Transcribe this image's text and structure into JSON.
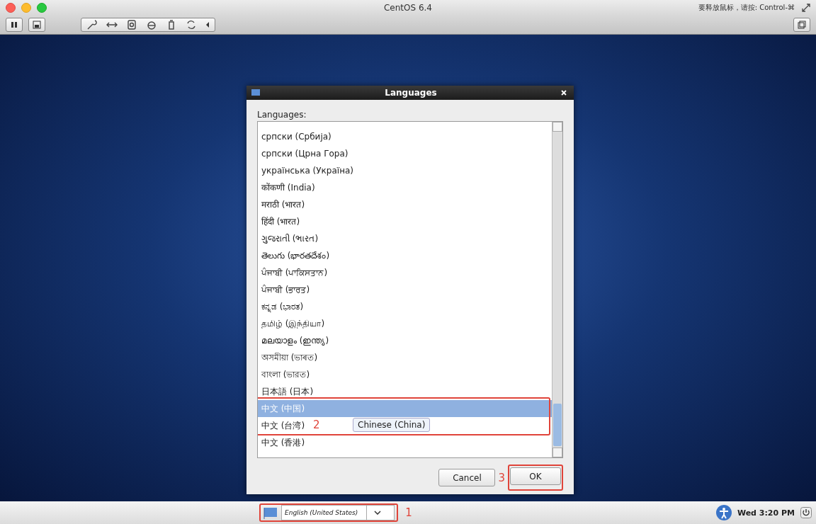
{
  "window": {
    "title": "CentOS 6.4",
    "release_hint": "要释放鼠标，请按: Control-⌘"
  },
  "dialog": {
    "title": "Languages",
    "list_label": "Languages:",
    "tooltip": "Chinese (China)",
    "selection_callout": "2",
    "languages": [
      {
        "label": "српски (Србија)",
        "selected": false
      },
      {
        "label": "српски (Црна Гора)",
        "selected": false
      },
      {
        "label": "українська (Україна)",
        "selected": false
      },
      {
        "label": "कोंकणी (India)",
        "selected": false
      },
      {
        "label": "मराठी (भारत)",
        "selected": false
      },
      {
        "label": "हिंदी (भारत)",
        "selected": false
      },
      {
        "label": "ગુજરાતી (ભારત)",
        "selected": false
      },
      {
        "label": "తెలుగు (భారతదేశం)",
        "selected": false
      },
      {
        "label": "ਪੰਜਾਬੀ (ਪਾਕਿਸਤਾਨ)",
        "selected": false
      },
      {
        "label": "ਪੰਜਾਬੀ (ਭਾਰਤ)",
        "selected": false
      },
      {
        "label": "ಕನ್ನಡ (ಭಾರತ)",
        "selected": false
      },
      {
        "label": "தமிழ் (இந்தியா)",
        "selected": false
      },
      {
        "label": "മലയാളം (ഇന്ത്യ)",
        "selected": false
      },
      {
        "label": "অসমীয়া (ভাৰত)",
        "selected": false
      },
      {
        "label": "বাংলা (ভারত)",
        "selected": false
      },
      {
        "label": "日本語 (日本)",
        "selected": false
      },
      {
        "label": "中文 (中国)",
        "selected": true
      },
      {
        "label": "中文 (台湾)",
        "selected": false
      },
      {
        "label": "中文 (香港)",
        "selected": false
      }
    ],
    "buttons": [
      {
        "label": "Cancel",
        "kind": "cancel"
      },
      {
        "label": "OK",
        "kind": "ok",
        "callout": "3"
      }
    ]
  },
  "panel": {
    "language": "English (United States)",
    "callout": "1",
    "clock": "Wed 3:20 PM"
  }
}
